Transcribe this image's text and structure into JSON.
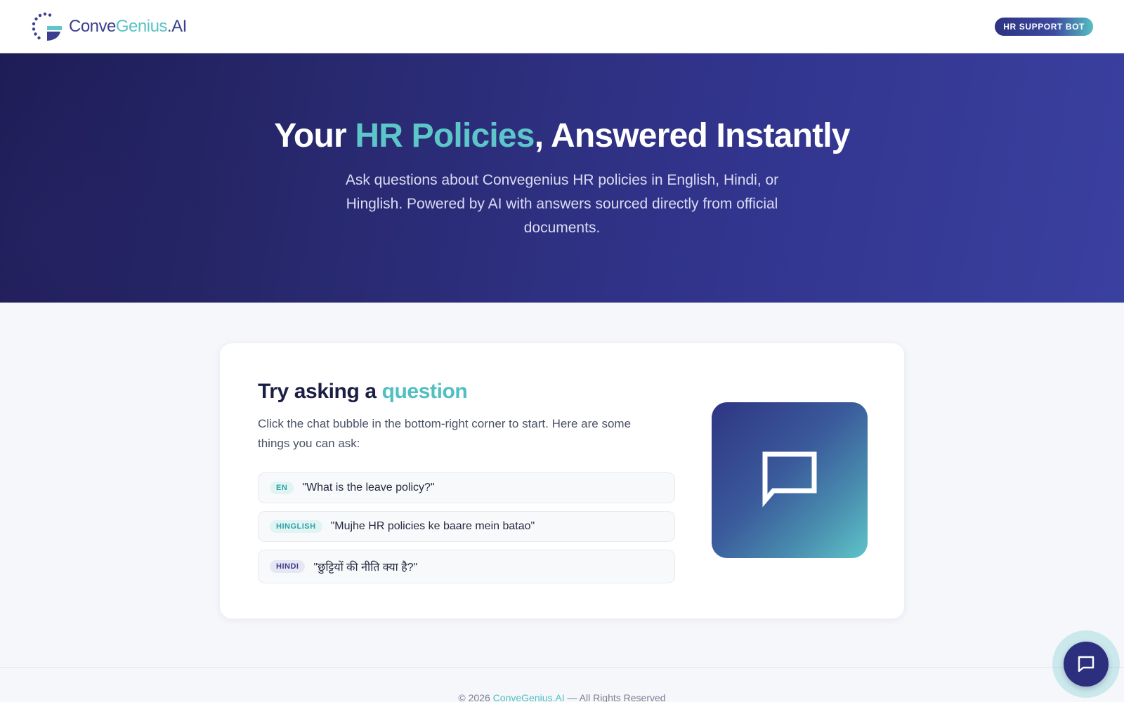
{
  "header": {
    "logo": {
      "part1": "Conve",
      "part2": "Genius",
      "part3": ".AI"
    },
    "badge": "HR SUPPORT BOT"
  },
  "hero": {
    "title_before": "Your ",
    "title_accent": "HR Policies",
    "title_after": ", Answered Instantly",
    "subtitle": "Ask questions about Convegenius HR policies in English, Hindi, or Hinglish. Powered by AI with answers sourced directly from official documents."
  },
  "card": {
    "title_before": "Try asking a ",
    "title_accent": "question",
    "description": "Click the chat bubble in the bottom-right corner to start. Here are some things you can ask:",
    "questions": [
      {
        "tag": "EN",
        "text": "\"What is the leave policy?\""
      },
      {
        "tag": "HINGLISH",
        "text": "\"Mujhe HR policies ke baare mein batao\""
      },
      {
        "tag": "HINDI",
        "text": "\"छुट्टियों की नीति क्या है?\""
      }
    ]
  },
  "footer": {
    "before": "© 2026 ",
    "accent": "ConveGenius.AI",
    "after": " — All Rights Reserved"
  },
  "colors": {
    "brand_dark": "#2c2f7e",
    "brand_teal": "#5cc6c9",
    "hero_start": "#1d1c55",
    "hero_end": "#3a40a0"
  },
  "icons": {
    "logo": "convegenius-logo-icon",
    "chat_tile": "chat-bubble-icon",
    "fab": "chat-bubble-icon"
  }
}
